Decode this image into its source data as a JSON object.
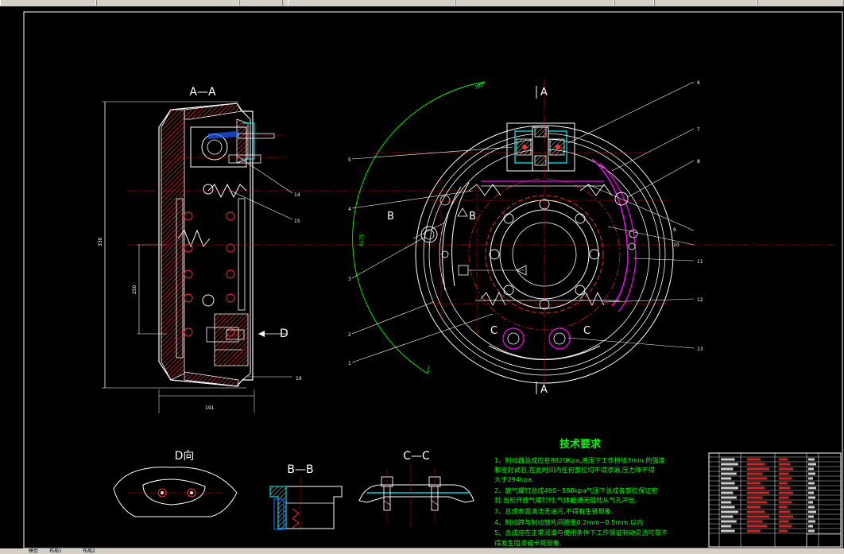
{
  "titles": {
    "section_aa": "A—A",
    "view_d": "D向",
    "section_bb": "B—B",
    "section_cc": "C—C",
    "tech_req": "技术要求"
  },
  "markers": {
    "a_top": "A",
    "a_bottom": "A",
    "b_left": "B",
    "b_right": "B",
    "c_left": "C",
    "c_right": "C",
    "d_arrow": "D"
  },
  "leaders_left": [
    "14",
    "15",
    "16"
  ],
  "leaders_main_left": [
    "5",
    "4",
    "3",
    "2",
    "1"
  ],
  "leaders_main_right": [
    "6",
    "7",
    "8",
    "9",
    "10",
    "11",
    "12",
    "13"
  ],
  "dimensions": {
    "overall_height": "330",
    "hub_height": "250",
    "width": "191"
  },
  "tech_notes": [
    "1、制动器总成应在8820Kpa,液压下工作持续3min 的强度",
    "和密封试验,在此时间内任何部位均不得渗漏,压力降不得",
    "大于294kpa.",
    "2、放气螺钉总成490~588kpa气压下总成各部位保证密",
    "封,当松开放气螺钉时,气体能通无阻地从气孔冲出.",
    "3、总成表面清洁无油污,不得有生锈现象.",
    "4、制动蹄与制动鼓片间隙量0.2mm~0.5mm.以内",
    "5、总成应在正常润滑与使用条件下工作保证制动灵活可靠不",
    "得发生阻滞或卡死现象."
  ],
  "bottom_tabs": [
    "模型",
    "布局1",
    "布局2"
  ],
  "colors": {
    "background": "#000000",
    "outline": "#ffffff",
    "centerline": "#ff0000",
    "dimension": "#00ff00",
    "hatch": "#ff3030",
    "blue": "#2060ff",
    "cyan": "#00ffff",
    "magenta": "#ff00ff",
    "text": "#ffffff",
    "notes": "#00ff00"
  }
}
